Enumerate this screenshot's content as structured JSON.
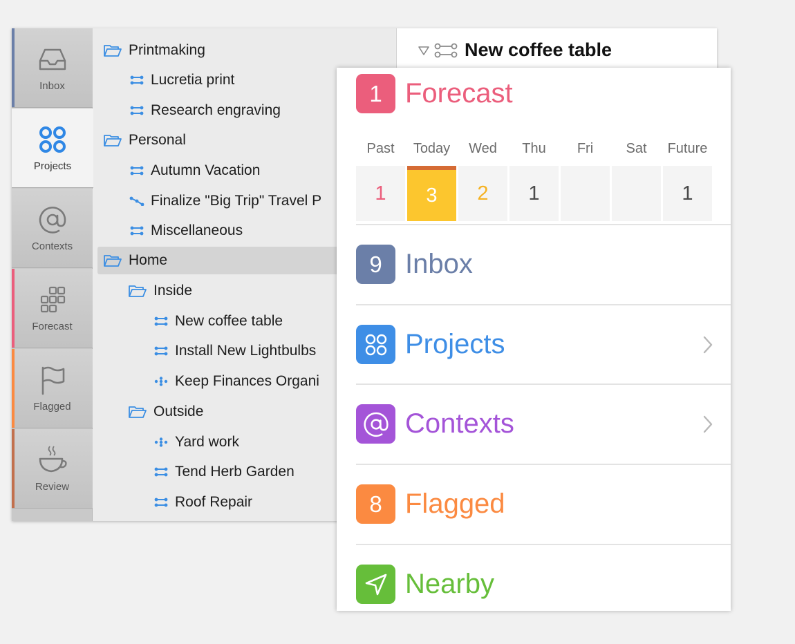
{
  "colors": {
    "inbox": "#6b7fa8",
    "projects": "#3e8ee6",
    "contexts": "#a454d8",
    "forecast": "#eb5e7c",
    "flagged": "#fb8a41",
    "review": "#c2704d",
    "nearby": "#66be3a",
    "today_fill": "#fcc62e"
  },
  "sidebar": {
    "items": [
      {
        "label": "Inbox",
        "icon": "inbox-tray-icon"
      },
      {
        "label": "Projects",
        "icon": "projects-circles-icon"
      },
      {
        "label": "Contexts",
        "icon": "at-sign-icon"
      },
      {
        "label": "Forecast",
        "icon": "forecast-grid-icon"
      },
      {
        "label": "Flagged",
        "icon": "flag-icon"
      },
      {
        "label": "Review",
        "icon": "coffee-cup-icon"
      }
    ]
  },
  "outline": {
    "rows": [
      {
        "label": "Printmaking",
        "kind": "folder"
      },
      {
        "label": "Lucretia print",
        "kind": "project"
      },
      {
        "label": "Research engraving",
        "kind": "project"
      },
      {
        "label": "Personal",
        "kind": "folder"
      },
      {
        "label": "Autumn Vacation",
        "kind": "project"
      },
      {
        "label": "Finalize \"Big Trip\" Travel P",
        "kind": "sequential"
      },
      {
        "label": "Miscellaneous",
        "kind": "project"
      },
      {
        "label": "Home",
        "kind": "folder"
      },
      {
        "label": "Inside",
        "kind": "folder"
      },
      {
        "label": "New coffee table",
        "kind": "project"
      },
      {
        "label": "Install New Lightbulbs",
        "kind": "project"
      },
      {
        "label": "Keep Finances Organi",
        "kind": "single-actions"
      },
      {
        "label": "Outside",
        "kind": "folder"
      },
      {
        "label": "Yard work",
        "kind": "single-actions"
      },
      {
        "label": "Tend Herb Garden",
        "kind": "project"
      },
      {
        "label": "Roof Repair",
        "kind": "project"
      }
    ]
  },
  "detail": {
    "title": "New coffee table"
  },
  "ios": {
    "forecast": {
      "count": "1",
      "label": "Forecast",
      "days": [
        {
          "name": "Past",
          "count": "1"
        },
        {
          "name": "Today",
          "count": "3"
        },
        {
          "name": "Wed",
          "count": "2"
        },
        {
          "name": "Thu",
          "count": "1"
        },
        {
          "name": "Fri",
          "count": ""
        },
        {
          "name": "Sat",
          "count": ""
        },
        {
          "name": "Future",
          "count": "1"
        }
      ]
    },
    "inbox": {
      "count": "9",
      "label": "Inbox"
    },
    "projects": {
      "label": "Projects"
    },
    "contexts": {
      "label": "Contexts"
    },
    "flagged": {
      "count": "8",
      "label": "Flagged"
    },
    "nearby": {
      "label": "Nearby"
    }
  }
}
